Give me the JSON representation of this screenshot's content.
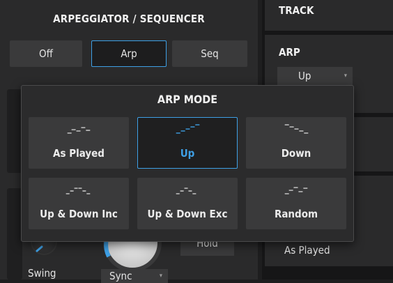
{
  "left_panel": {
    "title": "ARPEGGIATOR / SEQUENCER",
    "mode_buttons": [
      {
        "label": "Off",
        "active": false
      },
      {
        "label": "Arp",
        "active": true
      },
      {
        "label": "Seq",
        "active": false
      }
    ],
    "swing_label": "Swing",
    "sync_value": "Sync",
    "hold_label": "Hold"
  },
  "right_panel": {
    "track_title": "TRACK",
    "arp_title": "ARP",
    "arp_value": "Up",
    "mode_value": "As Played"
  },
  "popup": {
    "title": "ARP MODE",
    "selected": "Up",
    "options": [
      {
        "label": "As Played",
        "icon": "pattern-as-played-icon"
      },
      {
        "label": "Up",
        "icon": "pattern-up-icon"
      },
      {
        "label": "Down",
        "icon": "pattern-down-icon"
      },
      {
        "label": "Up & Down Inc",
        "icon": "pattern-up-down-inc-icon"
      },
      {
        "label": "Up & Down Exc",
        "icon": "pattern-up-down-exc-icon"
      },
      {
        "label": "Random",
        "icon": "pattern-random-icon"
      }
    ]
  },
  "colors": {
    "accent": "#3ea0e6",
    "panel": "#2a2a2b",
    "button": "#3a3a3b",
    "background": "#1e1e1f"
  }
}
